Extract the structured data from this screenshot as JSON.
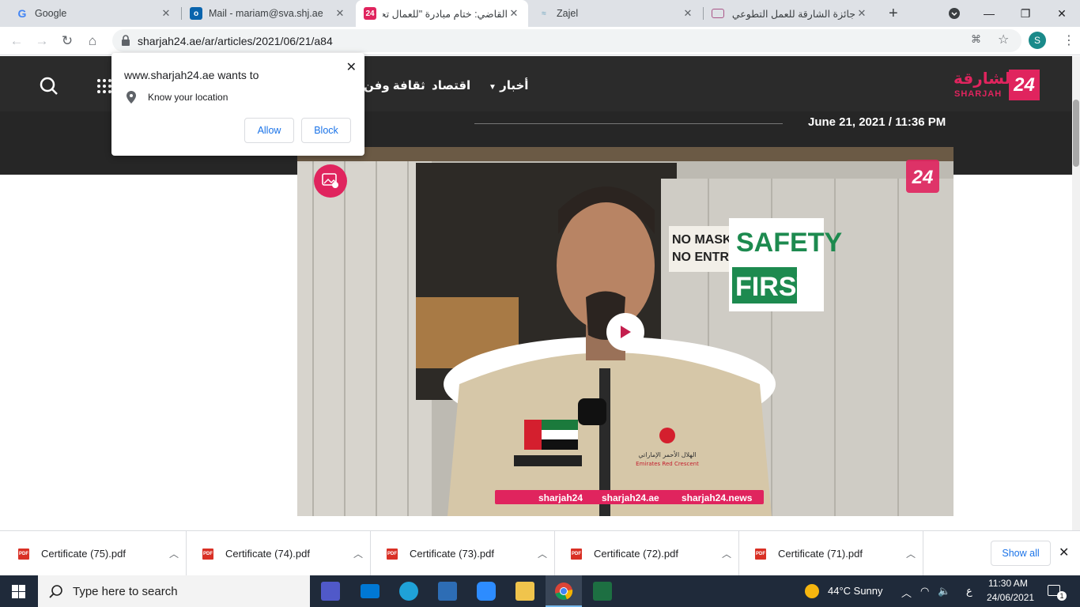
{
  "browser": {
    "tabs": [
      {
        "title": "Google",
        "favicon": "google-icon"
      },
      {
        "title": "Mail - mariam@sva.shj.ae",
        "favicon": "outlook-icon"
      },
      {
        "title": "القاضي: ختام مبادرة \"للعمال تحـ",
        "favicon": "sharjah24-icon",
        "active": true
      },
      {
        "title": "Zajel",
        "favicon": "zajel-icon"
      },
      {
        "title": "جائزة الشارقة للعمل التطوعي",
        "favicon": "page-icon"
      }
    ],
    "new_tab": "+",
    "url": "sharjah24.ae/ar/articles/2021/06/21/a84",
    "profile_initial": "S"
  },
  "permission_popup": {
    "title": "www.sharjah24.ae wants to",
    "permission": "Know your location",
    "allow": "Allow",
    "block": "Block"
  },
  "site": {
    "logo_ar": "الشارقة",
    "logo_en": "SHARJAH",
    "logo_badge": "24",
    "nav": [
      "أخبار",
      "اقتصاد",
      "ثقافة وفن"
    ],
    "date": "June 21, 2021 / 11:36 PM",
    "accent": "#e0245e"
  },
  "video": {
    "badge": "24",
    "signs": [
      "NO MASK",
      "NO ENTRY",
      "SAFETY",
      "FIRST"
    ],
    "social_strip": [
      "sharjah24",
      "sharjah24.ae",
      "sharjah24.news"
    ],
    "vest_text_ar": "الهلال الأحمر الإماراتي",
    "vest_text_en": "Emirates Red Crescent"
  },
  "downloads": {
    "items": [
      "Certificate (75).pdf",
      "Certificate (74).pdf",
      "Certificate (73).pdf",
      "Certificate (72).pdf",
      "Certificate (71).pdf"
    ],
    "show_all": "Show all"
  },
  "taskbar": {
    "search_placeholder": "Type here to search",
    "weather": "44°C  Sunny",
    "lang": "ع",
    "time": "11:30 AM",
    "date": "24/06/2021",
    "notifications": "1"
  }
}
